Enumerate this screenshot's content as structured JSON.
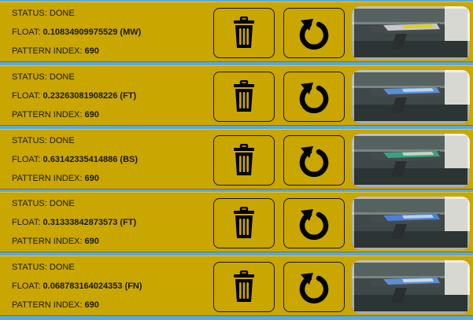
{
  "labels": {
    "status": "STATUS:",
    "float": "FLOAT:",
    "pattern": "PATTERN INDEX:"
  },
  "icons": {
    "delete": "trash-icon",
    "reload": "refresh-icon"
  },
  "colors": {
    "row_background": "#c9a600",
    "page_background": "#5aa8dc",
    "icon": "#000000"
  },
  "items": [
    {
      "status": "DONE",
      "float": "0.10834909975529 (MW)",
      "pattern_index": "690",
      "skin_colors": [
        "#c8c8c8",
        "#e0d000"
      ]
    },
    {
      "status": "DONE",
      "float": "0.23263081908226 (FT)",
      "pattern_index": "690",
      "skin_colors": [
        "#5a90d8",
        "#c8d8e8"
      ]
    },
    {
      "status": "DONE",
      "float": "0.63142335414886 (BS)",
      "pattern_index": "690",
      "skin_colors": [
        "#3aa080",
        "#d8d8c8"
      ]
    },
    {
      "status": "DONE",
      "float": "0.31333842873573 (FT)",
      "pattern_index": "690",
      "skin_colors": [
        "#4a80d8",
        "#c8d8e8"
      ]
    },
    {
      "status": "DONE",
      "float": "0.068783164024353 (FN)",
      "pattern_index": "690",
      "skin_colors": [
        "#5a90d8",
        "#d8e0ea"
      ]
    }
  ]
}
